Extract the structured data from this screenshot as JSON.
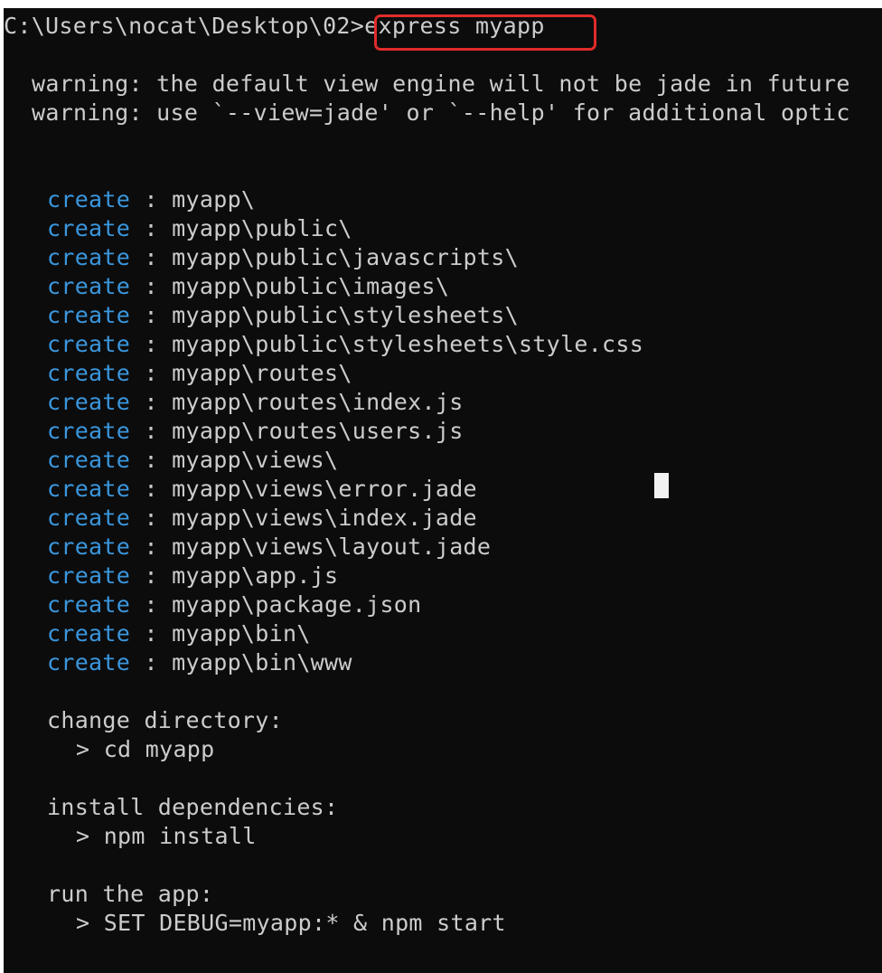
{
  "prompt": {
    "path": "C:\\Users\\nocat\\Desktop\\02>",
    "command": "express myapp"
  },
  "warnings": [
    "warning: the default view engine will not be jade in future",
    "warning: use `--view=jade' or `--help' for additional optic"
  ],
  "create_label": "create",
  "created_files": [
    ": myapp\\",
    ": myapp\\public\\",
    ": myapp\\public\\javascripts\\",
    ": myapp\\public\\images\\",
    ": myapp\\public\\stylesheets\\",
    ": myapp\\public\\stylesheets\\style.css",
    ": myapp\\routes\\",
    ": myapp\\routes\\index.js",
    ": myapp\\routes\\users.js",
    ": myapp\\views\\",
    ": myapp\\views\\error.jade",
    ": myapp\\views\\index.jade",
    ": myapp\\views\\layout.jade",
    ": myapp\\app.js",
    ": myapp\\package.json",
    ": myapp\\bin\\",
    ": myapp\\bin\\www"
  ],
  "instructions": {
    "change_dir_label": "change directory:",
    "change_dir_cmd": "> cd myapp",
    "install_label": "install dependencies:",
    "install_cmd": "> npm install",
    "run_label": "run the app:",
    "run_cmd": "> SET DEBUG=myapp:* & npm start"
  },
  "colors": {
    "background": "#0c0c0c",
    "text": "#cccccc",
    "create": "#3a96dd",
    "highlight": "#e02b2b"
  }
}
